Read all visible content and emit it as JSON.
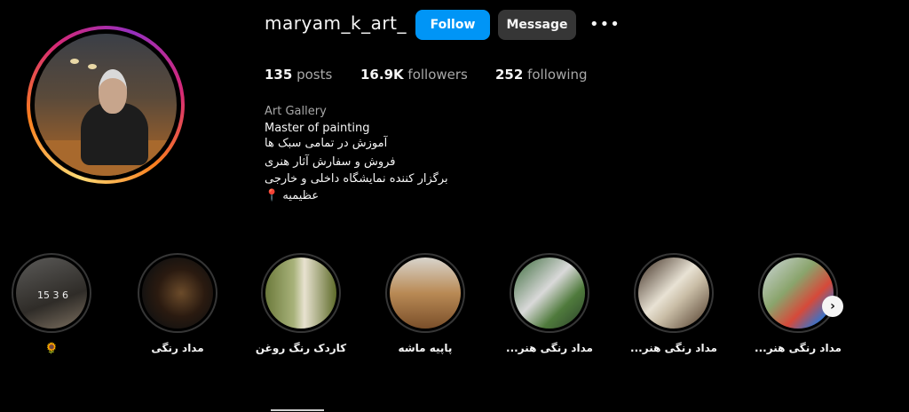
{
  "profile": {
    "username": "maryam_k_art_",
    "follow_label": "Follow",
    "message_label": "Message",
    "more_label": "•••"
  },
  "stats": {
    "posts_count": "135",
    "posts_label": "posts",
    "followers_count": "16.9K",
    "followers_label": "followers",
    "following_count": "252",
    "following_label": "following"
  },
  "bio": {
    "category": "Art Gallery",
    "title": "Master of painting",
    "line1": "آموزش در تمامی سبک ها",
    "line2": "فروش و سفارش آثار هنری",
    "line3": "برگزار کننده نمایشگاه داخلی و خارجی",
    "line4": "عظیمیه",
    "pin_icon": "📍"
  },
  "highlights": [
    {
      "label": "🌻",
      "image_text": "15 3 6"
    },
    {
      "label": "مداد رنگی"
    },
    {
      "label": "کاردک رنگ روغن"
    },
    {
      "label": "پاپیه ماشه"
    },
    {
      "label": "مداد رنگی هنر..."
    },
    {
      "label": "مداد رنگی هنر..."
    },
    {
      "label": "مداد رنگی هنر..."
    }
  ],
  "next_icon": "›"
}
